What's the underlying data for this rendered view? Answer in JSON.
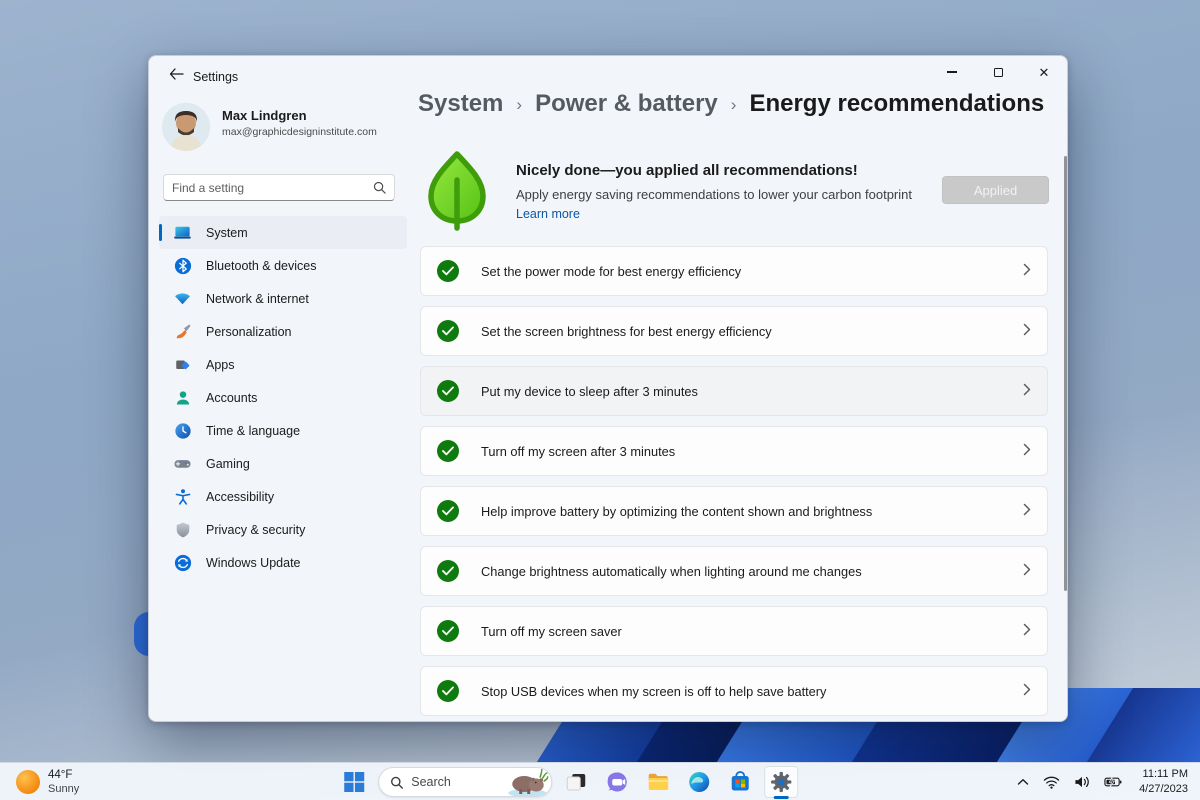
{
  "window": {
    "title": "Settings"
  },
  "user": {
    "name": "Max Lindgren",
    "email": "max@graphicdesigninstitute.com"
  },
  "search": {
    "placeholder": "Find a setting"
  },
  "sidebar": {
    "items": [
      {
        "label": "System",
        "icon": "system-icon",
        "selected": true
      },
      {
        "label": "Bluetooth & devices",
        "icon": "bluetooth-icon"
      },
      {
        "label": "Network & internet",
        "icon": "network-icon"
      },
      {
        "label": "Personalization",
        "icon": "personalization-icon"
      },
      {
        "label": "Apps",
        "icon": "apps-icon"
      },
      {
        "label": "Accounts",
        "icon": "accounts-icon"
      },
      {
        "label": "Time & language",
        "icon": "time-language-icon"
      },
      {
        "label": "Gaming",
        "icon": "gaming-icon"
      },
      {
        "label": "Accessibility",
        "icon": "accessibility-icon"
      },
      {
        "label": "Privacy & security",
        "icon": "privacy-icon"
      },
      {
        "label": "Windows Update",
        "icon": "windows-update-icon"
      }
    ]
  },
  "breadcrumb": {
    "items": [
      "System",
      "Power & battery",
      "Energy recommendations"
    ],
    "separator": "›"
  },
  "hero": {
    "title": "Nicely done—you applied all recommendations!",
    "subtitle": "Apply energy saving recommendations to lower your carbon footprint",
    "link": "Learn more",
    "button": "Applied",
    "icon": "leaf-icon"
  },
  "recs": {
    "items": [
      "Set the power mode for best energy efficiency",
      "Set the screen brightness for best energy efficiency",
      "Put my device to sleep after 3 minutes",
      "Turn off my screen after 3 minutes",
      "Help improve battery by optimizing the content shown and brightness",
      "Change brightness automatically when lighting around me changes",
      "Turn off my screen saver",
      "Stop USB devices when my screen is off to help save battery"
    ],
    "status_icon": "green-check-icon",
    "chevron": "›"
  },
  "taskbar": {
    "weather": {
      "temp": "44°F",
      "condition": "Sunny",
      "icon": "sun-icon"
    },
    "search_label": "Search",
    "apps": [
      "start",
      "search",
      "task-view",
      "chat",
      "file-explorer",
      "edge",
      "store",
      "settings"
    ],
    "active_app": "settings",
    "tray": {
      "time": "11:11 PM",
      "date": "4/27/2023",
      "icons": [
        "hidden-icons-chevron",
        "wifi",
        "volume",
        "battery"
      ]
    }
  },
  "colors": {
    "accent": "#0067c0",
    "success_green": "#0f7b0f",
    "link_blue": "#0a57a4",
    "leaf_green": "#6fd028"
  }
}
